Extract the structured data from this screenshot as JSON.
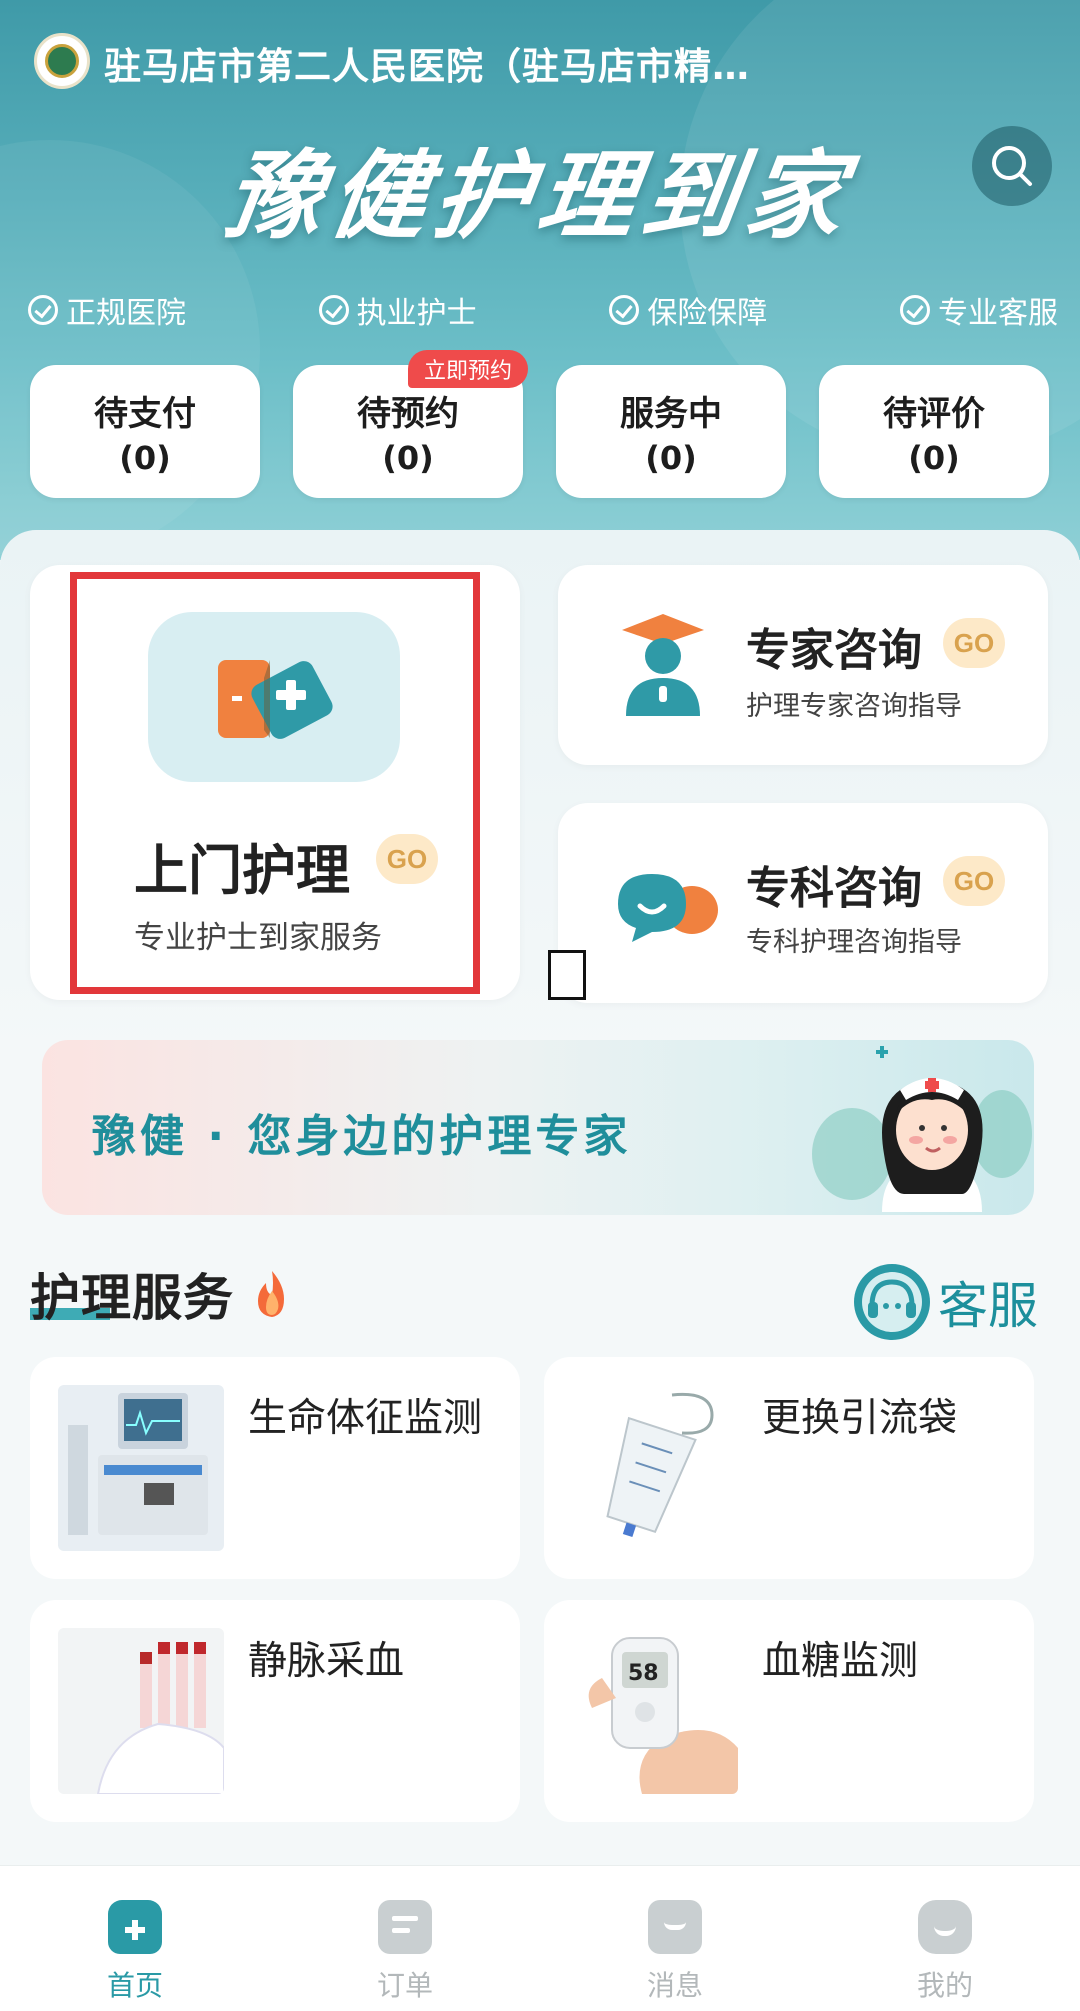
{
  "header": {
    "hospital_name": "驻马店市第二人民医院（驻马店市精…",
    "slogan": "豫健护理到家",
    "assurances": [
      "正规医院",
      "执业护士",
      "保险保障",
      "专业客服"
    ]
  },
  "order_status": [
    {
      "label": "待支付",
      "count": "(0)"
    },
    {
      "label": "待预约",
      "count": "(0)"
    },
    {
      "label": "服务中",
      "count": "(0)"
    },
    {
      "label": "待评价",
      "count": "(0)"
    }
  ],
  "book_badge": "立即预约",
  "main_services": {
    "home_care": {
      "title": "上门护理",
      "go": "GO",
      "subtitle": "专业护士到家服务"
    },
    "expert": {
      "title": "专家咨询",
      "go": "GO",
      "subtitle": "护理专家咨询指导"
    },
    "specialty": {
      "title": "专科咨询",
      "go": "GO",
      "subtitle": "专科护理咨询指导"
    }
  },
  "banner": {
    "text": "豫健 · 您身边的护理专家"
  },
  "section": {
    "title": "护理服务",
    "customer_service": "客服"
  },
  "services": [
    {
      "name": "生命体征监测"
    },
    {
      "name": "更换引流袋"
    },
    {
      "name": "静脉采血"
    },
    {
      "name": "血糖监测"
    }
  ],
  "tabs": [
    {
      "label": "首页",
      "active": true
    },
    {
      "label": "订单"
    },
    {
      "label": "消息"
    },
    {
      "label": "我的"
    }
  ],
  "colors": {
    "accent": "#2a9aa6",
    "highlight_border": "#e2373a",
    "badge_red": "#ef4b4b",
    "go_bg": "#fde9c8"
  }
}
